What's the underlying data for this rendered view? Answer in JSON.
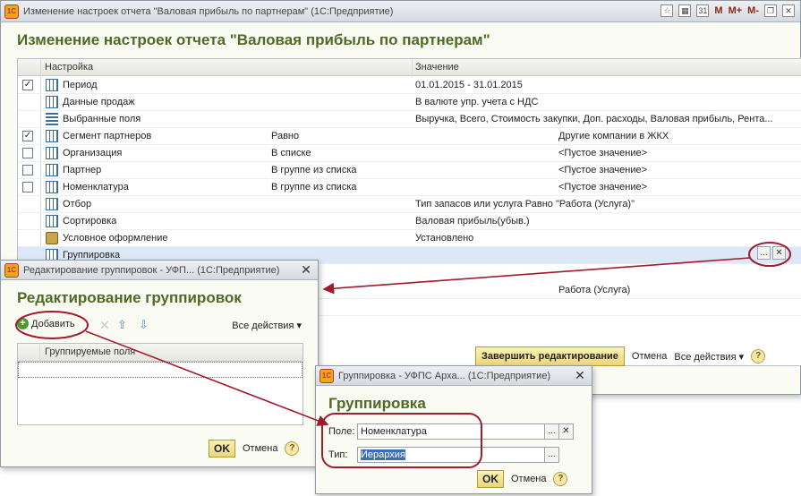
{
  "main_window": {
    "title": "Изменение настроек отчета \"Валовая прибыль по партнерам\"  (1С:Предприятие)",
    "heading": "Изменение настроек отчета \"Валовая прибыль по партнерам\"",
    "toolbar": {
      "m_label": "M",
      "m_plus_label": "M+",
      "m_minus_label": "M-",
      "calendar_day": "31"
    },
    "grid": {
      "columns": {
        "setting": "Настройка",
        "value": "Значение"
      },
      "rows": [
        {
          "checked": true,
          "has_checkbox": true,
          "icon": "table-icon",
          "name": "Период",
          "condition": "",
          "value": "01.01.2015 - 31.01.2015"
        },
        {
          "checked": false,
          "has_checkbox": false,
          "icon": "table-icon",
          "name": "Данные продаж",
          "condition": "",
          "value": "В валюте упр. учета с НДС"
        },
        {
          "checked": false,
          "has_checkbox": false,
          "icon": "list-icon",
          "name": "Выбранные поля",
          "condition": "",
          "value": "Выручка, Всего, Стоимость закупки, Доп. расходы, Валовая прибыль, Рента..."
        },
        {
          "checked": true,
          "has_checkbox": true,
          "icon": "table-icon",
          "name": "Сегмент партнеров",
          "condition": "Равно",
          "value": "Другие компании в ЖКХ"
        },
        {
          "checked": false,
          "has_checkbox": true,
          "icon": "table-icon",
          "name": "Организация",
          "condition": "В списке",
          "value": "<Пустое значение>"
        },
        {
          "checked": false,
          "has_checkbox": true,
          "icon": "table-icon",
          "name": "Партнер",
          "condition": "В группе из списка",
          "value": "<Пустое значение>"
        },
        {
          "checked": false,
          "has_checkbox": true,
          "icon": "table-icon",
          "name": "Номенклатура",
          "condition": "В группе из списка",
          "value": "<Пустое значение>"
        },
        {
          "checked": false,
          "has_checkbox": false,
          "icon": "table-icon",
          "name": "Отбор",
          "condition": "",
          "value": "Тип запасов или услуга Равно \"Работа (Услуга)\""
        },
        {
          "checked": false,
          "has_checkbox": false,
          "icon": "table-icon",
          "name": "Сортировка",
          "condition": "",
          "value": "Валовая прибыль(убыв.)"
        },
        {
          "checked": false,
          "has_checkbox": false,
          "icon": "condition-icon",
          "name": "Условное оформление",
          "condition": "",
          "value": "Установлено"
        },
        {
          "checked": false,
          "has_checkbox": false,
          "icon": "table-icon",
          "name": "Группировка",
          "condition": "",
          "value": ""
        }
      ],
      "partial_row_value": "Работа (Услуга)",
      "ellipsis_label": "...",
      "clear_label": "✕"
    },
    "footer": {
      "finish_label": "Завершить редактирование",
      "cancel_label": "Отмена",
      "all_actions_label": "Все действия",
      "help_label": "?"
    }
  },
  "group_editor": {
    "title": "Редактирование группировок - УФП... (1С:Предприятие)",
    "heading": "Редактирование группировок",
    "add_label": "Добавить",
    "all_actions_label": "Все действия",
    "column": "Группируемые поля",
    "ok_label": "OK",
    "cancel_label": "Отмена",
    "help_label": "?"
  },
  "group_dialog": {
    "title": "Группировка - УФПС Арха...  (1С:Предприятие)",
    "heading": "Группировка",
    "field_label": "Поле:",
    "field_value": "Номенклатура",
    "type_label": "Тип:",
    "type_value": "Иерархия",
    "ok_label": "OK",
    "cancel_label": "Отмена",
    "help_label": "?"
  },
  "colors": {
    "heading": "#4f6a24",
    "annotation": "#a01b2e",
    "default_button": "#ebd67a",
    "selection": "#3c6fb8"
  }
}
